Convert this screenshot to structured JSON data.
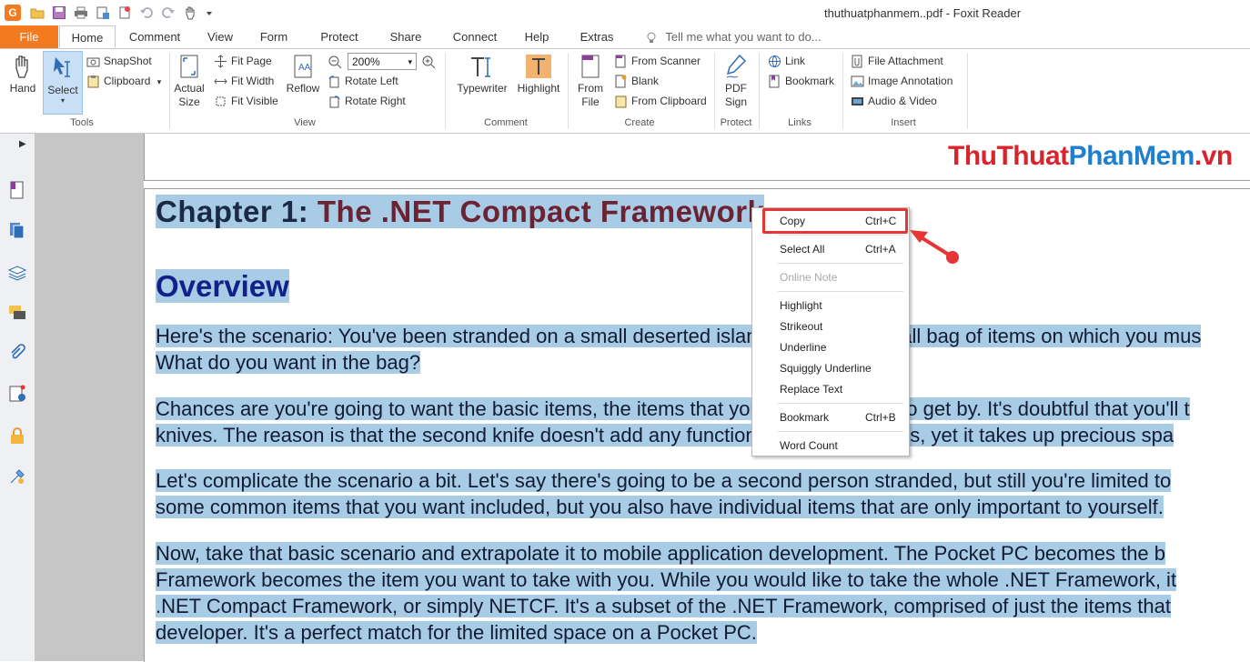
{
  "window": {
    "title": "thuthuatphanmem..pdf - Foxit Reader",
    "app_icon_glyph": "G",
    "accent": "#f47a20"
  },
  "tabs": [
    {
      "label": "File"
    },
    {
      "label": "Home"
    },
    {
      "label": "Comment"
    },
    {
      "label": "View"
    },
    {
      "label": "Form"
    },
    {
      "label": "Protect"
    },
    {
      "label": "Share"
    },
    {
      "label": "Connect"
    },
    {
      "label": "Help"
    },
    {
      "label": "Extras"
    }
  ],
  "tell_me": "Tell me what you want to do...",
  "ribbon": {
    "tools": {
      "label": "Tools",
      "hand": "Hand",
      "select": "Select",
      "snapshot": "SnapShot",
      "clipboard": "Clipboard"
    },
    "view": {
      "label": "View",
      "actual_size_1": "Actual",
      "actual_size_2": "Size",
      "fit_page": "Fit Page",
      "fit_width": "Fit Width",
      "fit_visible": "Fit Visible",
      "reflow": "Reflow",
      "zoom": "200%",
      "rotate_left": "Rotate Left",
      "rotate_right": "Rotate Right"
    },
    "comment": {
      "label": "Comment",
      "typewriter": "Typewriter",
      "highlight": "Highlight"
    },
    "create": {
      "label": "Create",
      "from_file_1": "From",
      "from_file_2": "File",
      "from_scanner": "From Scanner",
      "blank": "Blank",
      "from_clipboard": "From Clipboard"
    },
    "protect": {
      "label": "Protect",
      "pdf_sign_1": "PDF",
      "pdf_sign_2": "Sign"
    },
    "links": {
      "label": "Links",
      "link": "Link",
      "bookmark": "Bookmark"
    },
    "insert": {
      "label": "Insert",
      "file_attachment": "File Attachment",
      "image_annotation": "Image Annotation",
      "audio_video": "Audio & Video"
    }
  },
  "watermark": {
    "part1": "ThuThuat",
    "part2": "PhanMem",
    "part3": ".vn"
  },
  "document": {
    "chapter_prefix": "Chapter 1: ",
    "chapter_title": "The .NET Compact Framework",
    "overview": "Overview",
    "lines": [
      "Here's the scenario: You've been stranded on a small deserted island with only a small bag of items on which you mus",
      "What do you want in the bag?",
      "Chances are you're going to want the basic items, the items that you'll need to have to get by. It's doubtful that you'll t",
      "knives. The reason is that the second knife doesn't add any functionality or capabilities, yet it takes up precious spa",
      "Let's complicate the scenario a bit. Let's say there's going to be a second person stranded, but still you're limited to",
      "some common items that you want included, but you also have individual items that are only important to yourself.",
      "Now, take that basic scenario and extrapolate it to mobile application development. The Pocket PC becomes the b",
      "Framework becomes the item you want to take with you. While you would like to take the whole .NET Framework, it",
      ".NET Compact Framework, or simply NETCF. It's a subset of the .NET Framework, comprised of just the items that",
      "developer. It's a perfect match for the limited space on a Pocket PC."
    ]
  },
  "context_menu": {
    "copy": "Copy",
    "copy_sc": "Ctrl+C",
    "select_all": "Select All",
    "select_all_sc": "Ctrl+A",
    "online_note": "Online Note",
    "highlight": "Highlight",
    "strikeout": "Strikeout",
    "underline": "Underline",
    "squiggly": "Squiggly Underline",
    "replace": "Replace Text",
    "bookmark": "Bookmark",
    "bookmark_sc": "Ctrl+B",
    "word_count": "Word Count"
  },
  "colors": {
    "selection": "#a8cbe6",
    "annotation_red": "#e53535"
  }
}
